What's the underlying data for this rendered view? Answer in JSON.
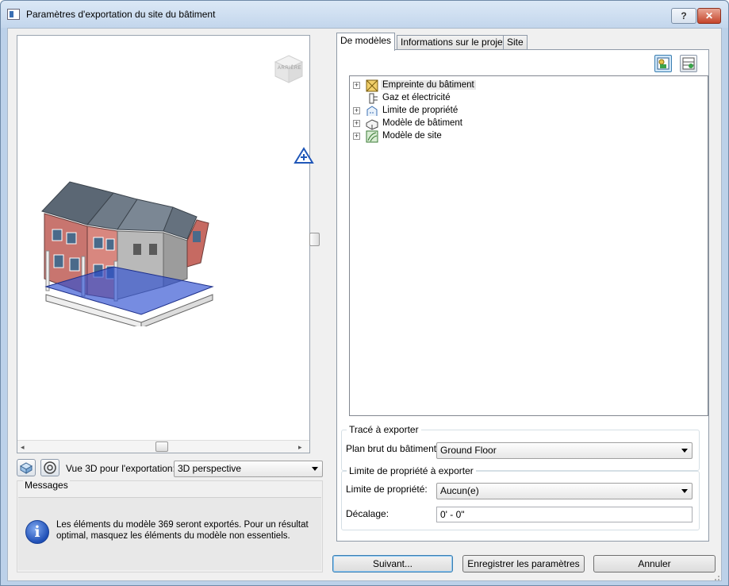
{
  "window": {
    "title": "Paramètres d'exportation du site du bâtiment",
    "help_label": "?",
    "close_label": "✕"
  },
  "preview": {
    "viewcube_label": "ARRIÈRE",
    "scroll_left": "◂",
    "scroll_right": "▸"
  },
  "view_row": {
    "label": "Vue 3D pour l'exportation:",
    "selected_view": "3D perspective"
  },
  "messages": {
    "legend": "Messages",
    "icon_glyph": "i",
    "text": "Les éléments du modèle 369 seront exportés. Pour un résultat optimal, masquez les éléments du modèle non essentiels."
  },
  "tabs": [
    {
      "label": "De modèles"
    },
    {
      "label": "Informations sur le projet"
    },
    {
      "label": "Site"
    }
  ],
  "tree": {
    "items": [
      {
        "label": "Empreinte du bâtiment",
        "expandable": true,
        "selected": true
      },
      {
        "label": "Gaz et électricité",
        "expandable": false
      },
      {
        "label": "Limite de propriété",
        "expandable": true
      },
      {
        "label": "Modèle de bâtiment",
        "expandable": true
      },
      {
        "label": "Modèle de site",
        "expandable": true
      }
    ],
    "plus_glyph": "+"
  },
  "trace_group": {
    "legend": "Tracé à exporter",
    "plan_label": "Plan brut du bâtiment:",
    "plan_value": "Ground Floor"
  },
  "property_group": {
    "legend": "Limite de propriété à exporter",
    "limit_label": "Limite de propriété:",
    "limit_value": "Aucun(e)",
    "offset_label": "Décalage:",
    "offset_value": "0' - 0\""
  },
  "buttons": {
    "next": "Suivant...",
    "save": "Enregistrer les paramètres",
    "cancel": "Annuler"
  }
}
